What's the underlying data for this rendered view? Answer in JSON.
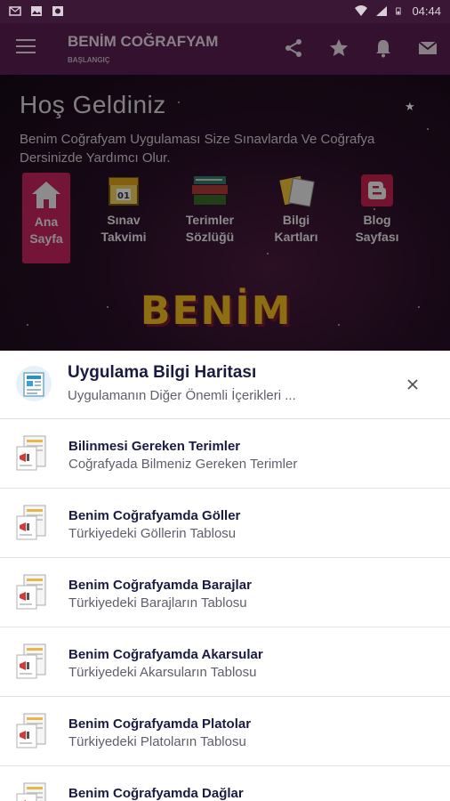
{
  "status_bar": {
    "time": "04:44"
  },
  "app_bar": {
    "title": "BENİM COĞRAFYAM",
    "subtitle": "BAŞLANGIÇ"
  },
  "hero": {
    "welcome": "Hoş Geldiniz",
    "description": "Benim Coğrafyam Uygulaması Size Sınavlarda Ve Coğrafya Dersinizde Yardımcı Olur.",
    "tiles": [
      {
        "line1": "Ana",
        "line2": "Sayfa"
      },
      {
        "line1": "Sınav",
        "line2": "Takvimi"
      },
      {
        "line1": "Terimler",
        "line2": "Sözlüğü"
      },
      {
        "line1": "Bilgi",
        "line2": "Kartları"
      },
      {
        "line1": "Blog",
        "line2": "Sayfası"
      }
    ],
    "logo": "BENİM"
  },
  "sheet": {
    "title": "Uygulama Bilgi Haritası",
    "subtitle": "Uygulamanın Diğer Önemli İçerikleri ...",
    "items": [
      {
        "title": "Bilinmesi Gereken Terimler",
        "subtitle": "Coğrafyada Bilmeniz Gereken Terimler"
      },
      {
        "title": "Benim Coğrafyamda Göller",
        "subtitle": "Türkiyedeki Göllerin Tablosu"
      },
      {
        "title": "Benim Coğrafyamda Barajlar",
        "subtitle": "Türkiyedeki Barajların Tablosu"
      },
      {
        "title": "Benim Coğrafyamda Akarsular",
        "subtitle": "Türkiyedeki Akarsuların Tablosu"
      },
      {
        "title": "Benim Coğrafyamda Platolar",
        "subtitle": "Türkiyedeki Platoların Tablosu"
      },
      {
        "title": "Benim Coğrafyamda Dağlar",
        "subtitle": ""
      }
    ]
  },
  "colors": {
    "app_bar": "#5a1f52",
    "accent": "#c8245f",
    "sheet_title": "#1a1b40"
  }
}
